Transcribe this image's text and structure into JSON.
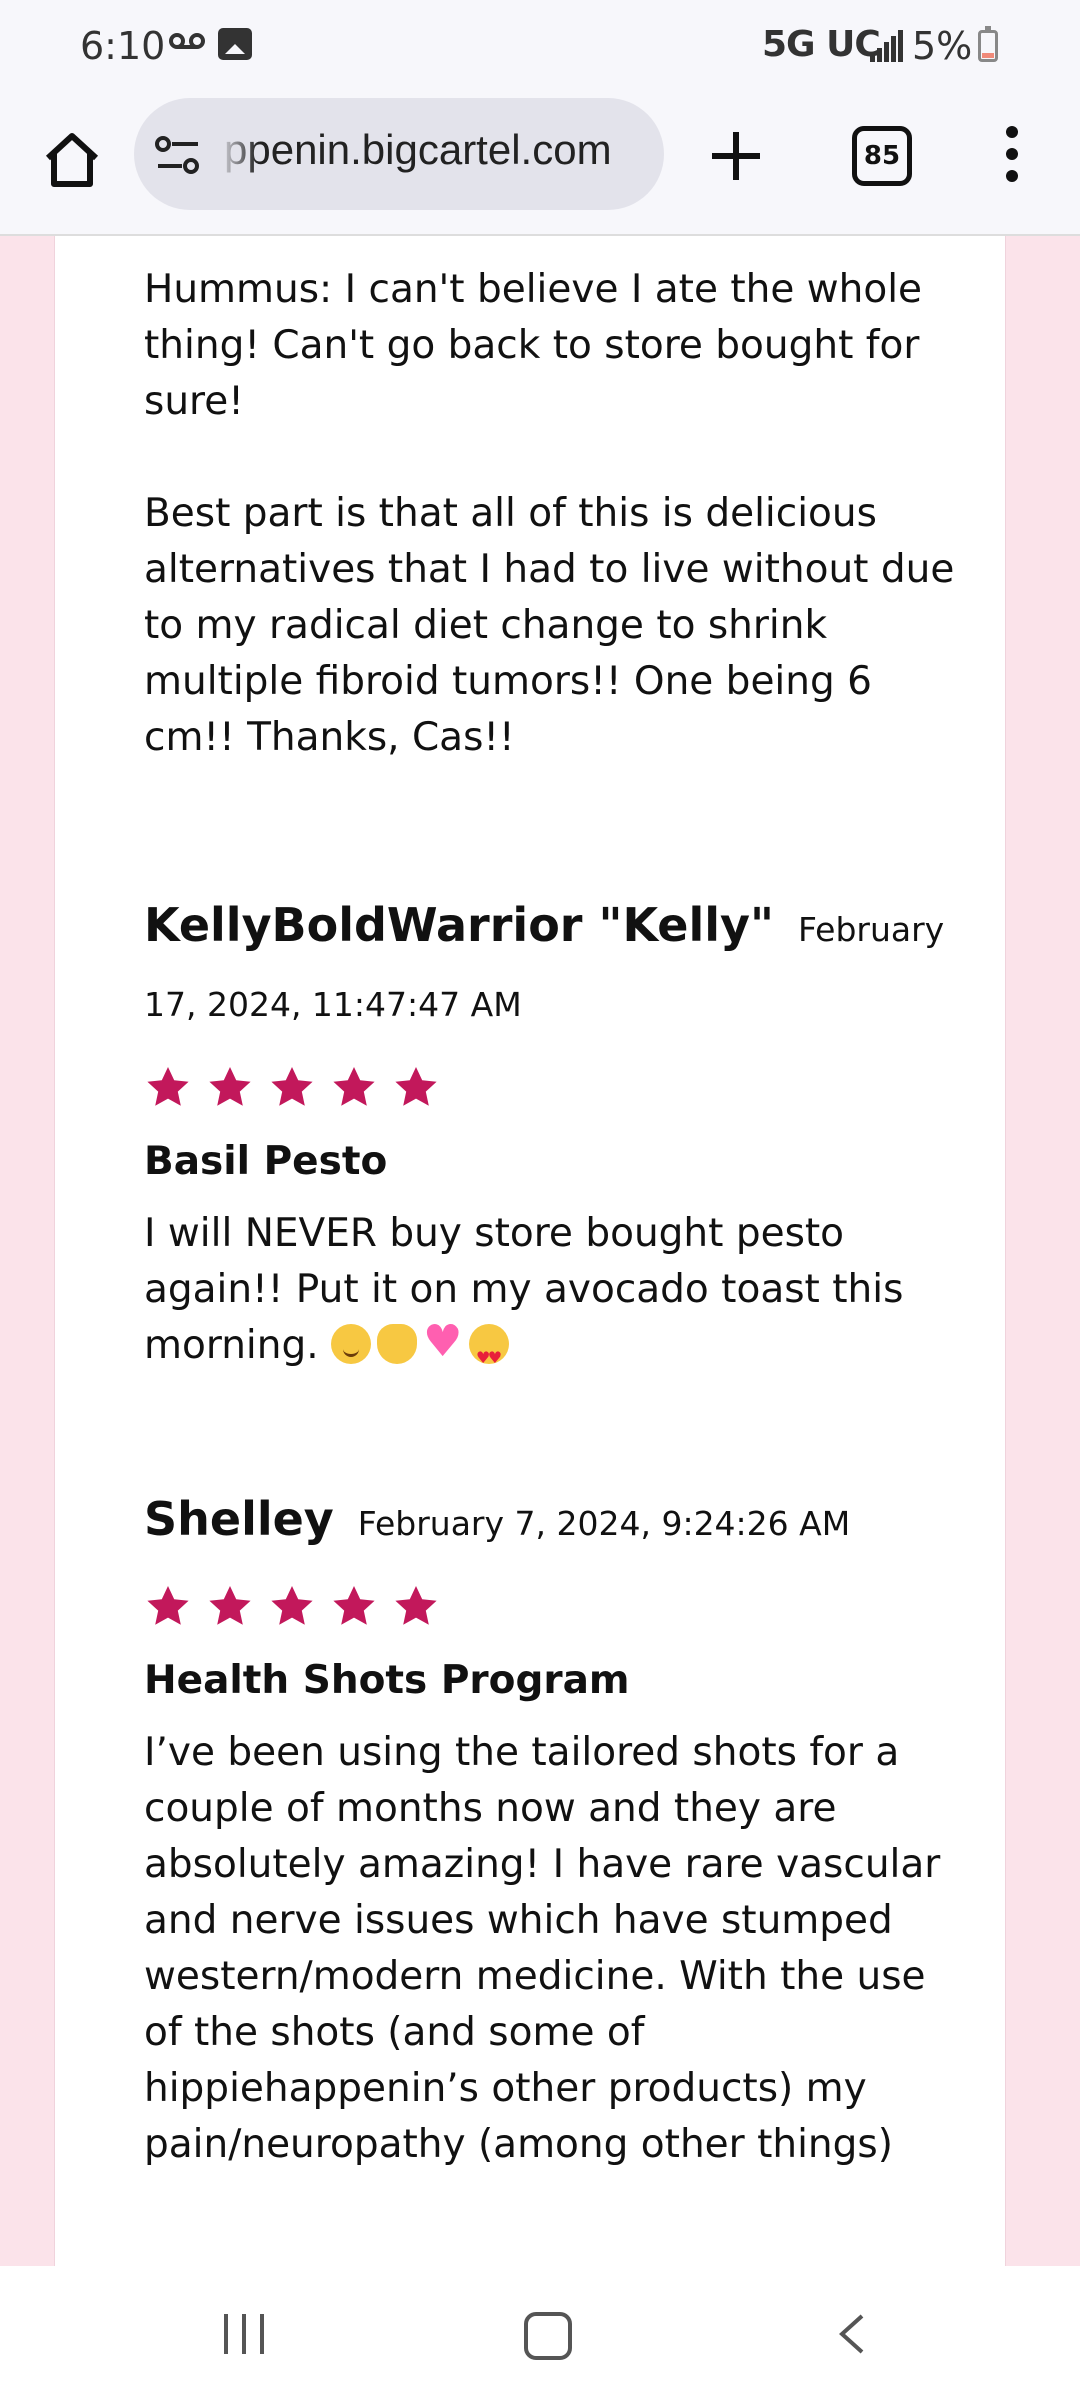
{
  "status_bar": {
    "time": "6:10",
    "network": "5G UC",
    "battery": "5%"
  },
  "browser": {
    "url": "ppenin.bigcartel.com",
    "tab_count": "85"
  },
  "content": {
    "intro_paragraphs": [
      "Hummus: I can't believe I ate the whole thing! Can't go back to store bought for sure!",
      "Best part is that all of this is delicious alternatives that I had to live without due to my radical diet change to shrink multiple fibroid tumors!! One being 6 cm!! Thanks, Cas!!"
    ],
    "reviews": [
      {
        "name": "KellyBoldWarrior \"Kelly\"",
        "date": "February 17, 2024, 11:47:47 AM",
        "rating": 5,
        "product": "Basil Pesto",
        "text": "I will NEVER buy store bought pesto again!! Put it on my avocado toast this morning."
      },
      {
        "name": "Shelley",
        "date": "February 7, 2024, 9:24:26 AM",
        "rating": 5,
        "product": "Health Shots Program",
        "text": "I’ve been using the tailored shots for a couple of months now and they are absolutely amazing! I have rare vascular and nerve issues which have stumped western/modern medicine. With the use of the shots (and some of hippiehappenin’s other products) my pain/neuropathy (among other things)"
      }
    ]
  },
  "colors": {
    "star": "#c2185b",
    "page_background": "#fbe3ea"
  },
  "icons": [
    "voicemail-icon",
    "image-icon",
    "signal-icon",
    "battery-icon",
    "home-icon",
    "site-settings-icon",
    "new-tab-icon",
    "tabs-icon",
    "menu-icon",
    "recent-apps-icon",
    "nav-home-icon",
    "back-icon",
    "star-icon"
  ]
}
